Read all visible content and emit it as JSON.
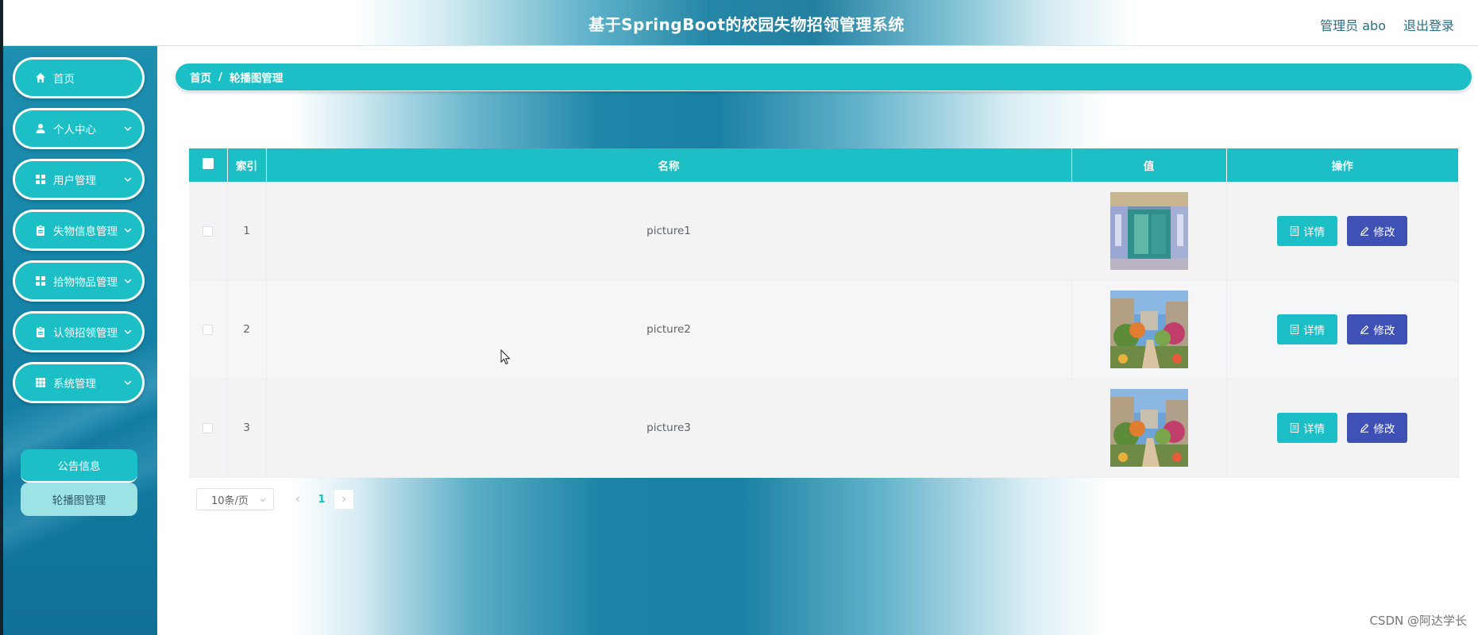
{
  "header": {
    "title": "基于SpringBoot的校园失物招领管理系统",
    "user": "管理员 abo",
    "logout": "退出登录"
  },
  "sidebar": {
    "items": [
      {
        "label": "首页",
        "icon": "home-icon",
        "has_arrow": false
      },
      {
        "label": "个人中心",
        "icon": "user-icon",
        "has_arrow": true
      },
      {
        "label": "用户管理",
        "icon": "grid-icon",
        "has_arrow": true
      },
      {
        "label": "失物信息管理",
        "icon": "clipboard-icon",
        "has_arrow": true
      },
      {
        "label": "拾物物品管理",
        "icon": "grid-icon",
        "has_arrow": true
      },
      {
        "label": "认领招领管理",
        "icon": "clipboard-icon",
        "has_arrow": true
      },
      {
        "label": "系统管理",
        "icon": "apps-icon",
        "has_arrow": true
      }
    ],
    "submenu": [
      {
        "label": "公告信息",
        "active": false
      },
      {
        "label": "轮播图管理",
        "active": true
      }
    ]
  },
  "breadcrumb": {
    "home": "首页",
    "separator": "/",
    "current": "轮播图管理"
  },
  "table": {
    "columns": [
      "索引",
      "名称",
      "值",
      "操作"
    ],
    "rows": [
      {
        "index": "1",
        "name": "picture1",
        "image": "corridor-photo"
      },
      {
        "index": "2",
        "name": "picture2",
        "image": "campus-garden-photo"
      },
      {
        "index": "3",
        "name": "picture3",
        "image": "campus-garden-photo"
      }
    ],
    "actions": {
      "detail": "详情",
      "edit": "修改"
    }
  },
  "pagination": {
    "page_size": "10条/页",
    "current_page": "1"
  },
  "watermark": "CSDN @阿达学长",
  "colors": {
    "primary": "#1bbfc5",
    "edit_button": "#3f51b5",
    "sidebar_bg": "#1583a8"
  }
}
